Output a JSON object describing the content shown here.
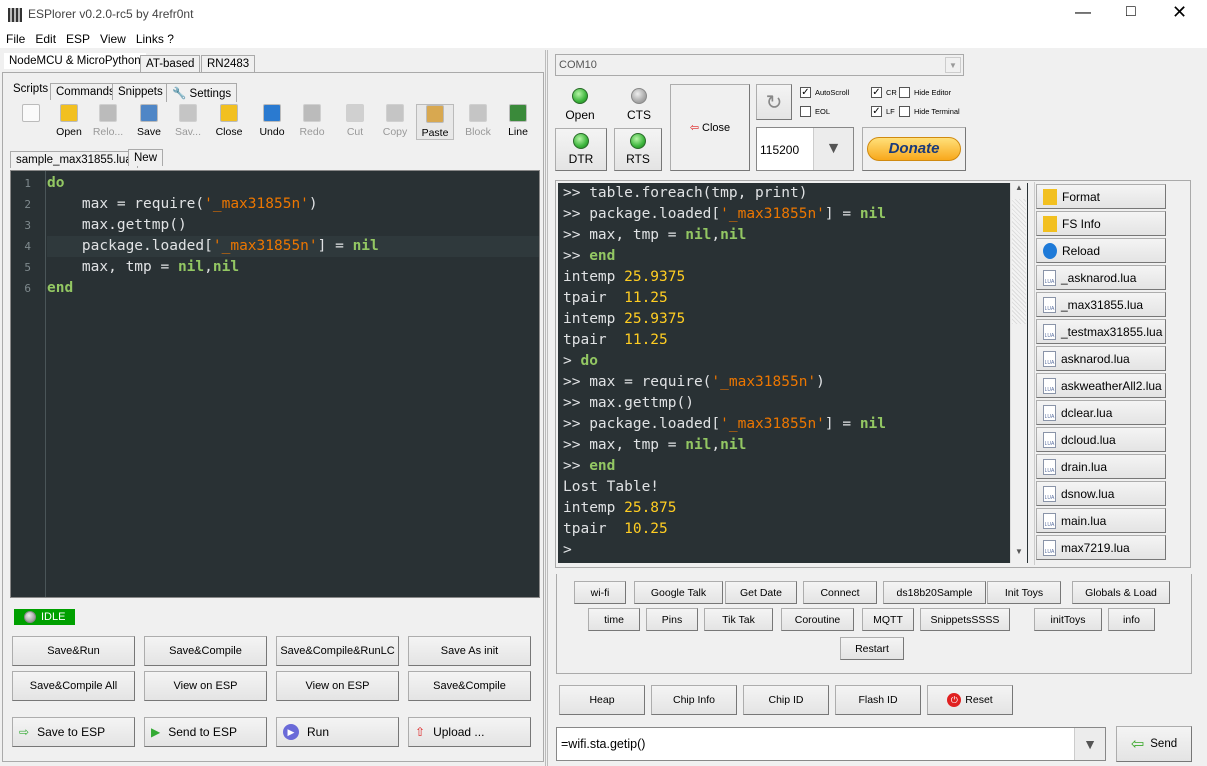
{
  "window": {
    "title": "ESPlorer v0.2.0-rc5 by 4refr0nt"
  },
  "menu": [
    "File",
    "Edit",
    "ESP",
    "View",
    "Links ?"
  ],
  "left": {
    "top_tabs": [
      "NodeMCU & MicroPython",
      "AT-based",
      "RN2483"
    ],
    "sub_tabs": [
      "Scripts",
      "Commands",
      "Snippets",
      "Settings"
    ],
    "toolbar": [
      {
        "label": "",
        "icon": "new-file-icon",
        "enabled": true
      },
      {
        "label": "Open",
        "icon": "folder-open-icon",
        "enabled": true
      },
      {
        "label": "Relo...",
        "icon": "reload-icon",
        "enabled": false
      },
      {
        "label": "Save",
        "icon": "floppy-icon",
        "enabled": true
      },
      {
        "label": "Sav...",
        "icon": "save-all-icon",
        "enabled": false
      },
      {
        "label": "Close",
        "icon": "folder-icon",
        "enabled": true
      },
      {
        "label": "Undo",
        "icon": "undo-icon",
        "enabled": true
      },
      {
        "label": "Redo",
        "icon": "redo-icon",
        "enabled": false
      },
      {
        "label": "Cut",
        "icon": "scissors-icon",
        "enabled": false
      },
      {
        "label": "Copy",
        "icon": "copy-icon",
        "enabled": false
      },
      {
        "label": "Paste",
        "icon": "paste-icon",
        "enabled": true
      },
      {
        "label": "Block",
        "icon": "block-icon",
        "enabled": false
      },
      {
        "label": "Line",
        "icon": "line-icon",
        "enabled": true
      }
    ],
    "file_tabs": [
      "sample_max31855.lua",
      "New"
    ],
    "editor_lines": [
      [
        [
          "do",
          "kw"
        ]
      ],
      [
        [
          "    max = require(",
          ""
        ],
        [
          "'_max31855n'",
          "st"
        ],
        [
          ")",
          ""
        ]
      ],
      [
        [
          "    max.gettmp()",
          ""
        ]
      ],
      [
        [
          "    package.loaded[",
          ""
        ],
        [
          "'_max31855n'",
          "st"
        ],
        [
          "] = ",
          ""
        ],
        [
          "nil",
          "kw"
        ]
      ],
      [
        [
          "    max, tmp = ",
          ""
        ],
        [
          "nil",
          "kw"
        ],
        [
          ",",
          ""
        ],
        [
          "nil",
          "kw"
        ]
      ],
      [
        [
          "end",
          "kw"
        ]
      ]
    ],
    "status": "IDLE",
    "buttons_row1": [
      "Save&Run",
      "Save&Compile",
      "Save&Compile&RunLC",
      "Save As init"
    ],
    "buttons_row2": [
      "Save&Compile All",
      "View on ESP",
      "View on ESP",
      "Save&Compile"
    ],
    "buttons_row3": [
      "Save to ESP",
      "Send to ESP",
      "Run",
      "Upload ..."
    ]
  },
  "right": {
    "port": "COM10",
    "leds": {
      "open": "Open",
      "cts": "CTS",
      "dtr": "DTR",
      "rts": "RTS"
    },
    "close_label": "Close",
    "checkboxes": [
      {
        "label": "AutoScroll",
        "checked": true
      },
      {
        "label": "EOL",
        "checked": false
      },
      {
        "label": "CR",
        "checked": true
      },
      {
        "label": "LF",
        "checked": true
      },
      {
        "label": "Hide Editor",
        "checked": false
      },
      {
        "label": "Hide Terminal",
        "checked": false
      }
    ],
    "baud": "115200",
    "donate": "Donate",
    "terminal_lines": [
      [
        [
          ">> table.foreach(tmp, print)",
          ""
        ]
      ],
      [
        [
          ">> package.loaded[",
          ""
        ],
        [
          "'_max31855n'",
          "st"
        ],
        [
          "] = ",
          ""
        ],
        [
          "nil",
          "kw"
        ]
      ],
      [
        [
          ">> max, tmp = ",
          ""
        ],
        [
          "nil",
          "kw"
        ],
        [
          ",",
          ""
        ],
        [
          "nil",
          "kw"
        ]
      ],
      [
        [
          ">> ",
          ""
        ],
        [
          "end",
          "kw"
        ]
      ],
      [
        [
          "intemp ",
          ""
        ],
        [
          "25.9375",
          "nu"
        ]
      ],
      [
        [
          "tpair  ",
          ""
        ],
        [
          "11.25",
          "nu"
        ]
      ],
      [
        [
          "intemp ",
          ""
        ],
        [
          "25.9375",
          "nu"
        ]
      ],
      [
        [
          "tpair  ",
          ""
        ],
        [
          "11.25",
          "nu"
        ]
      ],
      [
        [
          "> ",
          ""
        ],
        [
          "do",
          "kw"
        ]
      ],
      [
        [
          ">> max = require(",
          ""
        ],
        [
          "'_max31855n'",
          "st"
        ],
        [
          ")",
          ""
        ]
      ],
      [
        [
          ">> max.gettmp()",
          ""
        ]
      ],
      [
        [
          ">> package.loaded[",
          ""
        ],
        [
          "'_max31855n'",
          "st"
        ],
        [
          "] = ",
          ""
        ],
        [
          "nil",
          "kw"
        ]
      ],
      [
        [
          ">> max, tmp = ",
          ""
        ],
        [
          "nil",
          "kw"
        ],
        [
          ",",
          ""
        ],
        [
          "nil",
          "kw"
        ]
      ],
      [
        [
          ">> ",
          ""
        ],
        [
          "end",
          "kw"
        ]
      ],
      [
        [
          "Lost Table!",
          ""
        ]
      ],
      [
        [
          "intemp ",
          ""
        ],
        [
          "25.875",
          "nu"
        ]
      ],
      [
        [
          "tpair  ",
          ""
        ],
        [
          "10.25",
          "nu"
        ]
      ],
      [
        [
          ">",
          ""
        ]
      ]
    ],
    "fs_buttons": [
      "Format",
      "FS Info",
      "Reload"
    ],
    "files": [
      "_asknarod.lua",
      "_max31855.lua",
      "_testmax31855.lua",
      "asknarod.lua",
      "askweatherAll2.lua",
      "dclear.lua",
      "dcloud.lua",
      "drain.lua",
      "dsnow.lua",
      "main.lua",
      "max7219.lua"
    ],
    "snippets_row1": [
      "wi-fi",
      "Google Talk",
      "Get Date",
      "Connect",
      "ds18b20Sample",
      "Init Toys",
      "Globals & Load"
    ],
    "snippets_row2": [
      "time",
      "Pins",
      "Tik Tak",
      "Coroutine",
      "MQTT",
      "SnippetsSSSS",
      "initToys",
      "info"
    ],
    "snippets_row3": [
      "Restart"
    ],
    "commands": [
      "Heap",
      "Chip Info",
      "Chip ID",
      "Flash ID",
      "Reset"
    ],
    "command_input": "=wifi.sta.getip()",
    "send": "Send"
  },
  "colors": {
    "editor_bg": "#293134",
    "keyword": "#93c763",
    "string": "#ec7600",
    "number": "#ffcd22",
    "status_green": "#00a000"
  }
}
